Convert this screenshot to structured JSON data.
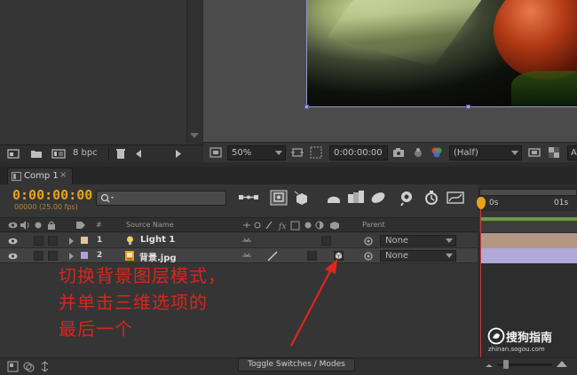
{
  "project_panel": {
    "bpc_label": "8 bpc"
  },
  "viewer": {
    "zoom": "50%",
    "timecode": "0:00:00:00",
    "resolution": "(Half)",
    "trailing_char": "A"
  },
  "timeline": {
    "tab_label": "Comp 1",
    "tab_close": "×",
    "timecode": "0:00:00:00",
    "frame_info": "00000 (25.00 fps)",
    "ruler_labels": [
      "0s",
      "01s"
    ],
    "columns": {
      "number": "#",
      "source_name": "Source Name",
      "parent": "Parent"
    },
    "layers": [
      {
        "number": "1",
        "name": "Light 1",
        "parent": "None",
        "label_color": "#e3c49a"
      },
      {
        "number": "2",
        "name": "背景.jpg",
        "parent": "None",
        "label_color": "#a9a3d8"
      }
    ],
    "toggle_button": "Toggle Switches / Modes"
  },
  "annotation": {
    "lines": [
      "切换背景图层模式，",
      "并单击三维选项的",
      "最后一个"
    ],
    "color": "#d8261e"
  },
  "watermark": {
    "name": "搜狗指南",
    "url": "zhinan.sogou.com"
  },
  "colors": {
    "timecode": "#e8a21a",
    "playhead": "#c93d3d",
    "track_light": "#b39783",
    "track_image": "#b0a8d6"
  }
}
